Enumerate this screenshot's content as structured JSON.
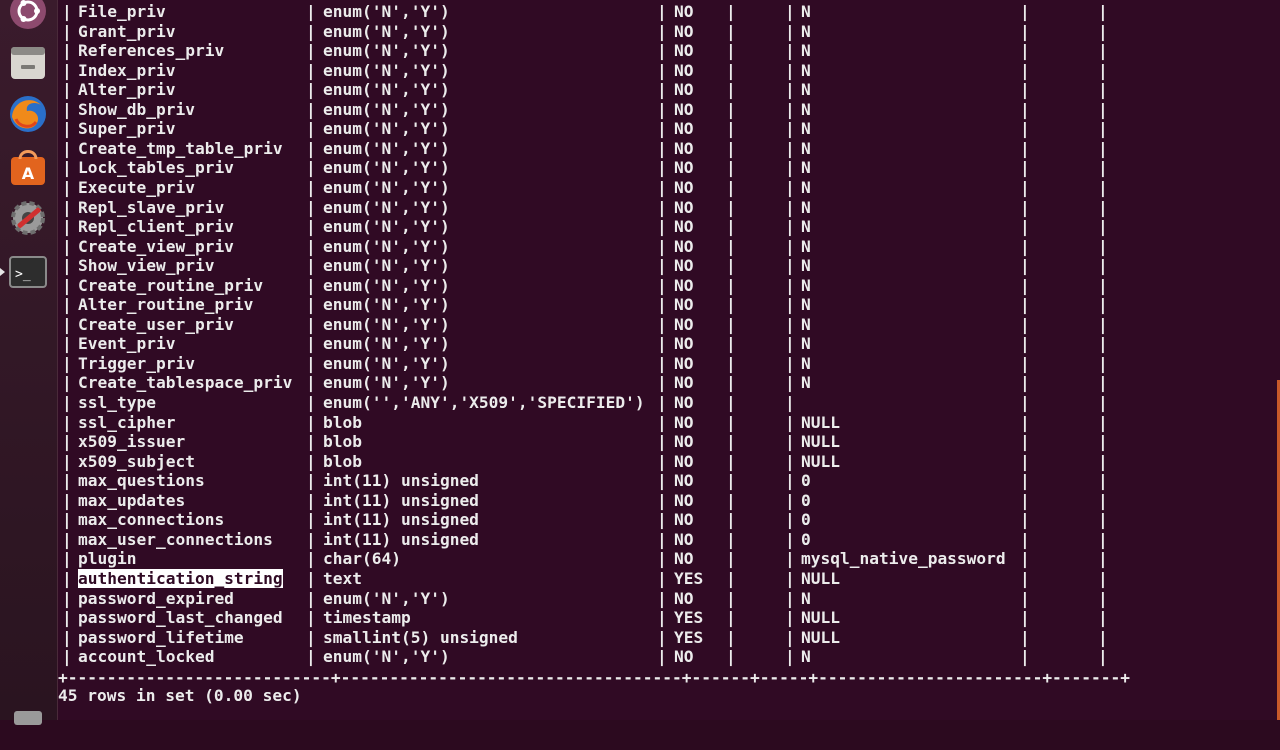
{
  "launcher": {
    "items": [
      {
        "name": "ubuntu-dash-icon"
      },
      {
        "name": "files-icon"
      },
      {
        "name": "firefox-icon"
      },
      {
        "name": "software-center-icon"
      },
      {
        "name": "system-settings-icon"
      },
      {
        "name": "terminal-icon"
      },
      {
        "name": "disk-icon"
      }
    ]
  },
  "terminal": {
    "rows": [
      {
        "field": "File_priv",
        "type": "enum('N','Y')",
        "null": "NO",
        "key": "",
        "default": "N",
        "extra": ""
      },
      {
        "field": "Grant_priv",
        "type": "enum('N','Y')",
        "null": "NO",
        "key": "",
        "default": "N",
        "extra": ""
      },
      {
        "field": "References_priv",
        "type": "enum('N','Y')",
        "null": "NO",
        "key": "",
        "default": "N",
        "extra": ""
      },
      {
        "field": "Index_priv",
        "type": "enum('N','Y')",
        "null": "NO",
        "key": "",
        "default": "N",
        "extra": ""
      },
      {
        "field": "Alter_priv",
        "type": "enum('N','Y')",
        "null": "NO",
        "key": "",
        "default": "N",
        "extra": ""
      },
      {
        "field": "Show_db_priv",
        "type": "enum('N','Y')",
        "null": "NO",
        "key": "",
        "default": "N",
        "extra": ""
      },
      {
        "field": "Super_priv",
        "type": "enum('N','Y')",
        "null": "NO",
        "key": "",
        "default": "N",
        "extra": ""
      },
      {
        "field": "Create_tmp_table_priv",
        "type": "enum('N','Y')",
        "null": "NO",
        "key": "",
        "default": "N",
        "extra": ""
      },
      {
        "field": "Lock_tables_priv",
        "type": "enum('N','Y')",
        "null": "NO",
        "key": "",
        "default": "N",
        "extra": ""
      },
      {
        "field": "Execute_priv",
        "type": "enum('N','Y')",
        "null": "NO",
        "key": "",
        "default": "N",
        "extra": ""
      },
      {
        "field": "Repl_slave_priv",
        "type": "enum('N','Y')",
        "null": "NO",
        "key": "",
        "default": "N",
        "extra": ""
      },
      {
        "field": "Repl_client_priv",
        "type": "enum('N','Y')",
        "null": "NO",
        "key": "",
        "default": "N",
        "extra": ""
      },
      {
        "field": "Create_view_priv",
        "type": "enum('N','Y')",
        "null": "NO",
        "key": "",
        "default": "N",
        "extra": ""
      },
      {
        "field": "Show_view_priv",
        "type": "enum('N','Y')",
        "null": "NO",
        "key": "",
        "default": "N",
        "extra": ""
      },
      {
        "field": "Create_routine_priv",
        "type": "enum('N','Y')",
        "null": "NO",
        "key": "",
        "default": "N",
        "extra": ""
      },
      {
        "field": "Alter_routine_priv",
        "type": "enum('N','Y')",
        "null": "NO",
        "key": "",
        "default": "N",
        "extra": ""
      },
      {
        "field": "Create_user_priv",
        "type": "enum('N','Y')",
        "null": "NO",
        "key": "",
        "default": "N",
        "extra": ""
      },
      {
        "field": "Event_priv",
        "type": "enum('N','Y')",
        "null": "NO",
        "key": "",
        "default": "N",
        "extra": ""
      },
      {
        "field": "Trigger_priv",
        "type": "enum('N','Y')",
        "null": "NO",
        "key": "",
        "default": "N",
        "extra": ""
      },
      {
        "field": "Create_tablespace_priv",
        "type": "enum('N','Y')",
        "null": "NO",
        "key": "",
        "default": "N",
        "extra": ""
      },
      {
        "field": "ssl_type",
        "type": "enum('','ANY','X509','SPECIFIED')",
        "null": "NO",
        "key": "",
        "default": "",
        "extra": ""
      },
      {
        "field": "ssl_cipher",
        "type": "blob",
        "null": "NO",
        "key": "",
        "default": "NULL",
        "extra": ""
      },
      {
        "field": "x509_issuer",
        "type": "blob",
        "null": "NO",
        "key": "",
        "default": "NULL",
        "extra": ""
      },
      {
        "field": "x509_subject",
        "type": "blob",
        "null": "NO",
        "key": "",
        "default": "NULL",
        "extra": ""
      },
      {
        "field": "max_questions",
        "type": "int(11) unsigned",
        "null": "NO",
        "key": "",
        "default": "0",
        "extra": ""
      },
      {
        "field": "max_updates",
        "type": "int(11) unsigned",
        "null": "NO",
        "key": "",
        "default": "0",
        "extra": ""
      },
      {
        "field": "max_connections",
        "type": "int(11) unsigned",
        "null": "NO",
        "key": "",
        "default": "0",
        "extra": ""
      },
      {
        "field": "max_user_connections",
        "type": "int(11) unsigned",
        "null": "NO",
        "key": "",
        "default": "0",
        "extra": ""
      },
      {
        "field": "plugin",
        "type": "char(64)",
        "null": "NO",
        "key": "",
        "default": "mysql_native_password",
        "extra": ""
      },
      {
        "field": "authentication_string",
        "type": "text",
        "null": "YES",
        "key": "",
        "default": "NULL",
        "extra": "",
        "selected": true
      },
      {
        "field": "password_expired",
        "type": "enum('N','Y')",
        "null": "NO",
        "key": "",
        "default": "N",
        "extra": ""
      },
      {
        "field": "password_last_changed",
        "type": "timestamp",
        "null": "YES",
        "key": "",
        "default": "NULL",
        "extra": ""
      },
      {
        "field": "password_lifetime",
        "type": "smallint(5) unsigned",
        "null": "YES",
        "key": "",
        "default": "NULL",
        "extra": ""
      },
      {
        "field": "account_locked",
        "type": "enum('N','Y')",
        "null": "NO",
        "key": "",
        "default": "N",
        "extra": ""
      }
    ],
    "separator": "+---------------------------+-----------------------------------+------+-----+-----------------------+-------+",
    "status": "45 rows in set (0.00 sec)"
  },
  "colors": {
    "terminal_bg": "#300a24",
    "text": "#ececec",
    "selection_bg": "#ffffff"
  }
}
